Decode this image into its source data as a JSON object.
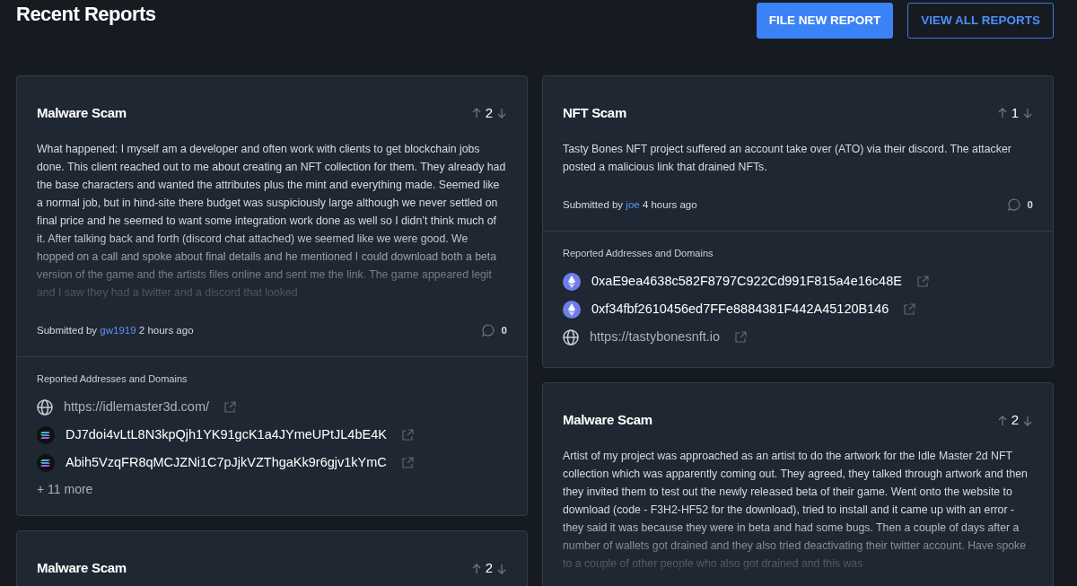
{
  "page": {
    "title": "Recent Reports"
  },
  "buttons": [
    {
      "label": "FILE NEW REPORT",
      "kind": "primary"
    },
    {
      "label": "VIEW ALL REPORTS",
      "kind": "outline"
    }
  ],
  "columns": [
    {
      "reports": [
        {
          "title": "Malware Scam",
          "votes": "2",
          "body": "What happened: I myself am a developer and often work with clients to get blockchain jobs done. This client reached out to me about creating an NFT collection for them. They already had the base characters and wanted the attributes plus the mint and everything made. Seemed like a normal job, but in hind-site there budget was suspiciously large although we never settled on final price and he seemed to want some integration work done as well so I didn’t think much of it. After talking back and forth (discord chat attached) we seemed like we were good. We hopped on a call and spoke about final details and he mentioned I could download both a beta version of the game and the artists files online and sent me the link. The game appeared legit and I saw they had a twitter and a discord that looked",
          "faded": true,
          "submitted_prefix": "Submitted by",
          "author": "gw1919",
          "time": "2 hours ago",
          "comments": "0",
          "addresses_heading": "Reported Addresses and Domains",
          "addresses": [
            {
              "kind": "domain",
              "text": "https://idlemaster3d.com/"
            },
            {
              "kind": "solana",
              "text": "DJ7doi4vLtL8N3kpQjh1YK91gcK1a4JYmeUPtJL4bE4K"
            },
            {
              "kind": "solana",
              "text": "Abih5VzqFR8qMCJZNi1C7pJjkVZThgaKk9r6gjv1kYmC"
            }
          ],
          "more": "+ 11 more"
        },
        {
          "title": "Malware Scam",
          "votes": "2"
        }
      ]
    },
    {
      "reports": [
        {
          "title": "NFT Scam",
          "votes": "1",
          "body": "Tasty Bones NFT project suffered an account take over (ATO) via their discord. The attacker posted a malicious link that drained NFTs.",
          "faded": false,
          "submitted_prefix": "Submitted by",
          "author": "joe",
          "time": "4 hours ago",
          "comments": "0",
          "addresses_heading": "Reported Addresses and Domains",
          "addresses": [
            {
              "kind": "ethereum",
              "text": "0xaE9ea4638c582F8797C922Cd991F815a4e16c48E"
            },
            {
              "kind": "ethereum",
              "text": "0xf34fbf2610456ed7FFe8884381F442A45120B146"
            },
            {
              "kind": "domain",
              "text": "https://tastybonesnft.io"
            }
          ]
        },
        {
          "title": "Malware Scam",
          "votes": "2",
          "body": "Artist of my project was approached as an artist to do the artwork for the Idle Master 2d NFT collection which was apparently coming out. They agreed, they talked through artwork and then they invited them to test out the newly released beta of their game. Went onto the website to download (code - F3H2-HF52 for the download), tried to install and it came up with an error - they said it was because they were in beta and had some bugs. Then a couple of days after a number of wallets got drained and they also tried deactivating their twitter account. Have spoke to a couple of other people who also got drained and this was",
          "faded": true
        }
      ]
    }
  ]
}
